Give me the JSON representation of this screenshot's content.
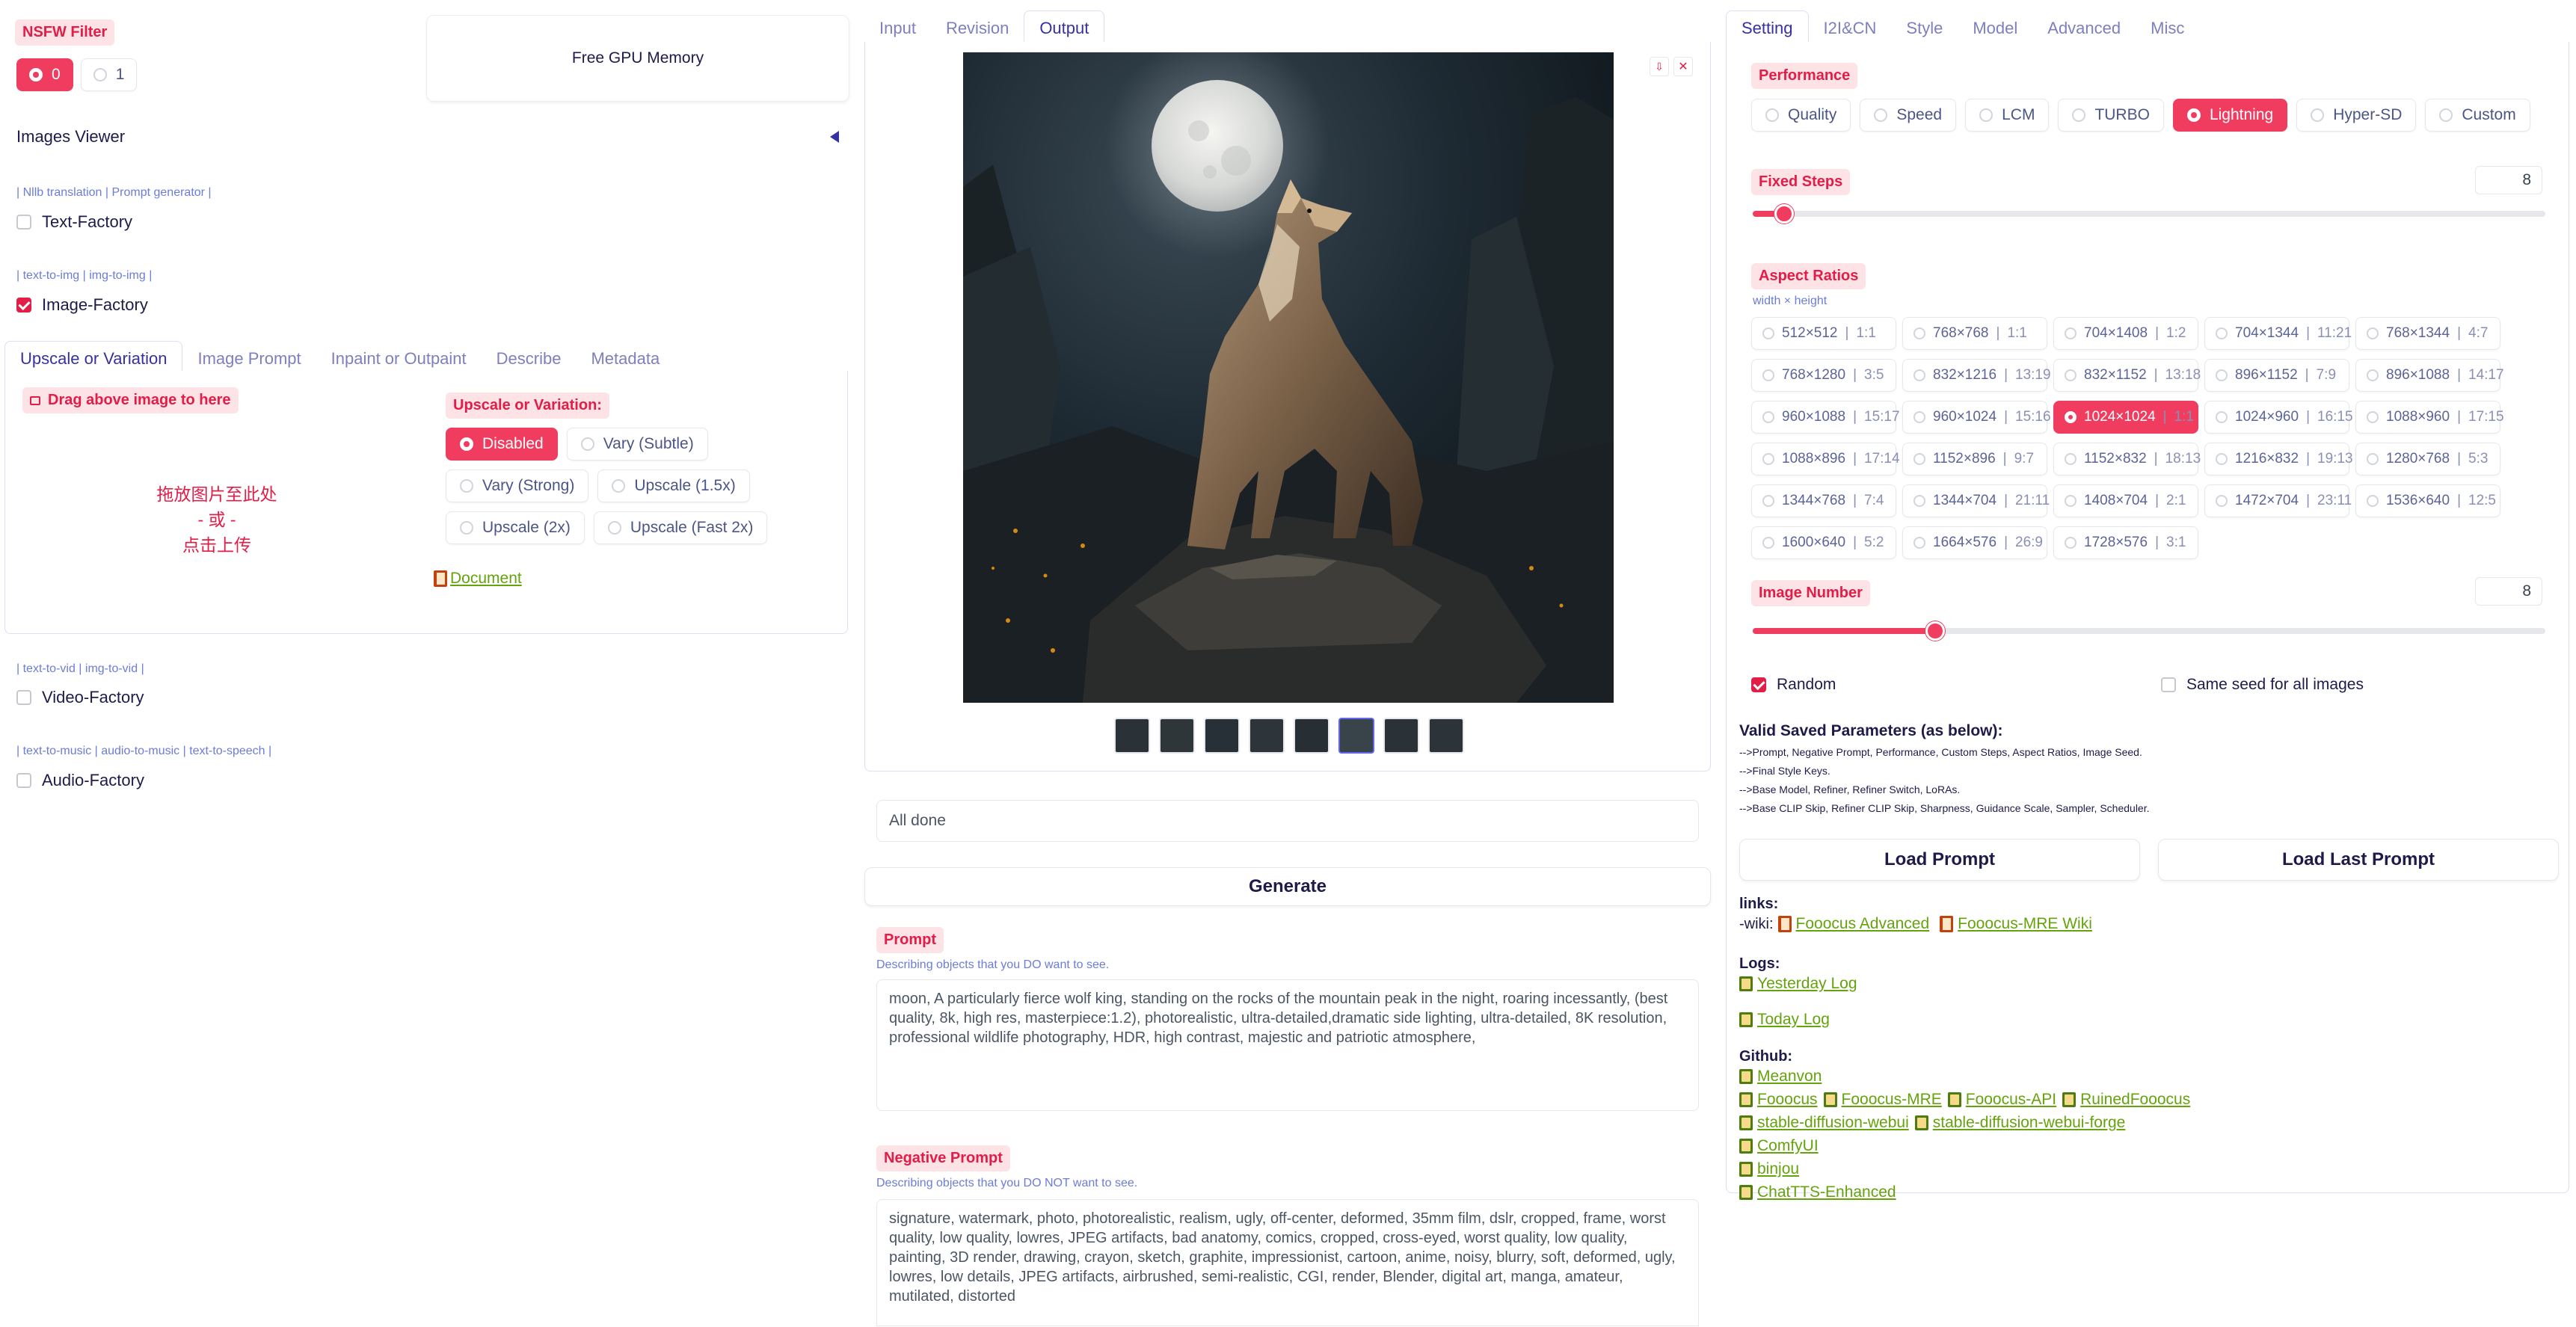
{
  "left": {
    "nsfw_label": "NSFW Filter",
    "nsfw_options": [
      "0",
      "1"
    ],
    "free_gpu": "Free GPU Memory",
    "images_viewer": "Images Viewer",
    "text_factory_hint": "| Nllb translation | Prompt generator |",
    "text_factory": "Text-Factory",
    "image_factory_hint": "| text-to-img | img-to-img |",
    "image_factory": "Image-Factory",
    "tabs": [
      "Upscale or Variation",
      "Image Prompt",
      "Inpaint or Outpaint",
      "Describe",
      "Metadata"
    ],
    "drag_label": "Drag above image to here",
    "drop_line1": "拖放图片至此处",
    "drop_line2": "- 或 -",
    "drop_line3": "点击上传",
    "upscale_label": "Upscale or Variation:",
    "upscale_options": [
      "Disabled",
      "Vary (Subtle)",
      "Vary (Strong)",
      "Upscale (1.5x)",
      "Upscale (2x)",
      "Upscale (Fast 2x)"
    ],
    "document": "Document",
    "video_factory_hint": "| text-to-vid | img-to-vid |",
    "video_factory": "Video-Factory",
    "audio_factory_hint": "| text-to-music | audio-to-music | text-to-speech |",
    "audio_factory": "Audio-Factory"
  },
  "middle": {
    "tabs": [
      "Input",
      "Revision",
      "Output"
    ],
    "status": "All done",
    "generate": "Generate",
    "prompt_label": "Prompt",
    "prompt_hint": "Describing objects that you DO want to see.",
    "prompt": "moon, A particularly fierce wolf king, standing on the rocks of the mountain peak in the night, roaring incessantly, (best quality, 8k, high res, masterpiece:1.2), photorealistic, ultra-detailed,dramatic side lighting, ultra-detailed, 8K resolution, professional wildlife photography, HDR, high contrast, majestic and patriotic atmosphere,",
    "neg_label": "Negative Prompt",
    "neg_hint": "Describing objects that you DO NOT want to see.",
    "negative_prompt": "signature, watermark, photo, photorealistic, realism, ugly, off-center, deformed, 35mm film, dslr, cropped, frame, worst quality, low quality, lowres, JPEG artifacts, bad anatomy, comics, cropped, cross-eyed, worst quality, low quality, painting, 3D render, drawing, crayon, sketch, graphite, impressionist, cartoon, anime, noisy, blurry, soft, deformed, ugly, lowres, low details, JPEG artifacts, airbrushed, semi-realistic, CGI, render, Blender, digital art, manga, amateur, mutilated, distorted"
  },
  "right": {
    "tabs": [
      "Setting",
      "I2I&CN",
      "Style",
      "Model",
      "Advanced",
      "Misc"
    ],
    "performance_label": "Performance",
    "performance": [
      "Quality",
      "Speed",
      "LCM",
      "TURBO",
      "Lightning",
      "Hyper-SD",
      "Custom"
    ],
    "fixed_steps_label": "Fixed Steps",
    "fixed_steps": "8",
    "fixed_steps_fraction": 0.04,
    "aspect_label": "Aspect Ratios",
    "aspect_hint": "width × height",
    "aspect_ratios": [
      [
        "512×512",
        "1:1"
      ],
      [
        "768×768",
        "1:1"
      ],
      [
        "704×1408",
        "1:2"
      ],
      [
        "704×1344",
        "11:21"
      ],
      [
        "768×1344",
        "4:7"
      ],
      [
        "768×1280",
        "3:5"
      ],
      [
        "832×1216",
        "13:19"
      ],
      [
        "832×1152",
        "13:18"
      ],
      [
        "896×1152",
        "7:9"
      ],
      [
        "896×1088",
        "14:17"
      ],
      [
        "960×1088",
        "15:17"
      ],
      [
        "960×1024",
        "15:16"
      ],
      [
        "1024×1024",
        "1:1"
      ],
      [
        "1024×960",
        "16:15"
      ],
      [
        "1088×960",
        "17:15"
      ],
      [
        "1088×896",
        "17:14"
      ],
      [
        "1152×896",
        "9:7"
      ],
      [
        "1152×832",
        "18:13"
      ],
      [
        "1216×832",
        "19:13"
      ],
      [
        "1280×768",
        "5:3"
      ],
      [
        "1344×768",
        "7:4"
      ],
      [
        "1344×704",
        "21:11"
      ],
      [
        "1408×704",
        "2:1"
      ],
      [
        "1472×704",
        "23:11"
      ],
      [
        "1536×640",
        "12:5"
      ],
      [
        "1600×640",
        "5:2"
      ],
      [
        "1664×576",
        "26:9"
      ],
      [
        "1728×576",
        "3:1"
      ]
    ],
    "image_number_label": "Image Number",
    "image_number": "8",
    "image_number_fraction": 0.23,
    "random": "Random",
    "same_seed": "Same seed for all images",
    "valid_title": "Valid Saved Parameters (as below):",
    "valid_lines": [
      "-->Prompt, Negative Prompt, Performance, Custom Steps, Aspect Ratios, Image Seed.",
      "-->Final Style Keys.",
      "-->Base Model, Refiner, Refiner Switch, LoRAs.",
      "-->Base CLIP Skip, Refiner CLIP Skip, Sharpness, Guidance Scale, Sampler, Scheduler."
    ],
    "load_prompt": "Load Prompt",
    "load_last_prompt": "Load Last Prompt",
    "links_title": "links:",
    "wiki_prefix": "-wiki:",
    "wiki_links": [
      "Fooocus Advanced",
      "Fooocus-MRE Wiki"
    ],
    "logs_title": "Logs:",
    "yesterday_log": "Yesterday Log",
    "today_log": "Today Log",
    "github_title": "Github:",
    "github_rows": [
      [
        "Meanvon"
      ],
      [
        "Fooocus",
        "Fooocus-MRE",
        "Fooocus-API",
        "RuinedFooocus"
      ],
      [
        "stable-diffusion-webui",
        "stable-diffusion-webui-forge"
      ],
      [
        "ComfyUI"
      ],
      [
        "binjou"
      ],
      [
        "ChatTTS-Enhanced"
      ]
    ]
  }
}
